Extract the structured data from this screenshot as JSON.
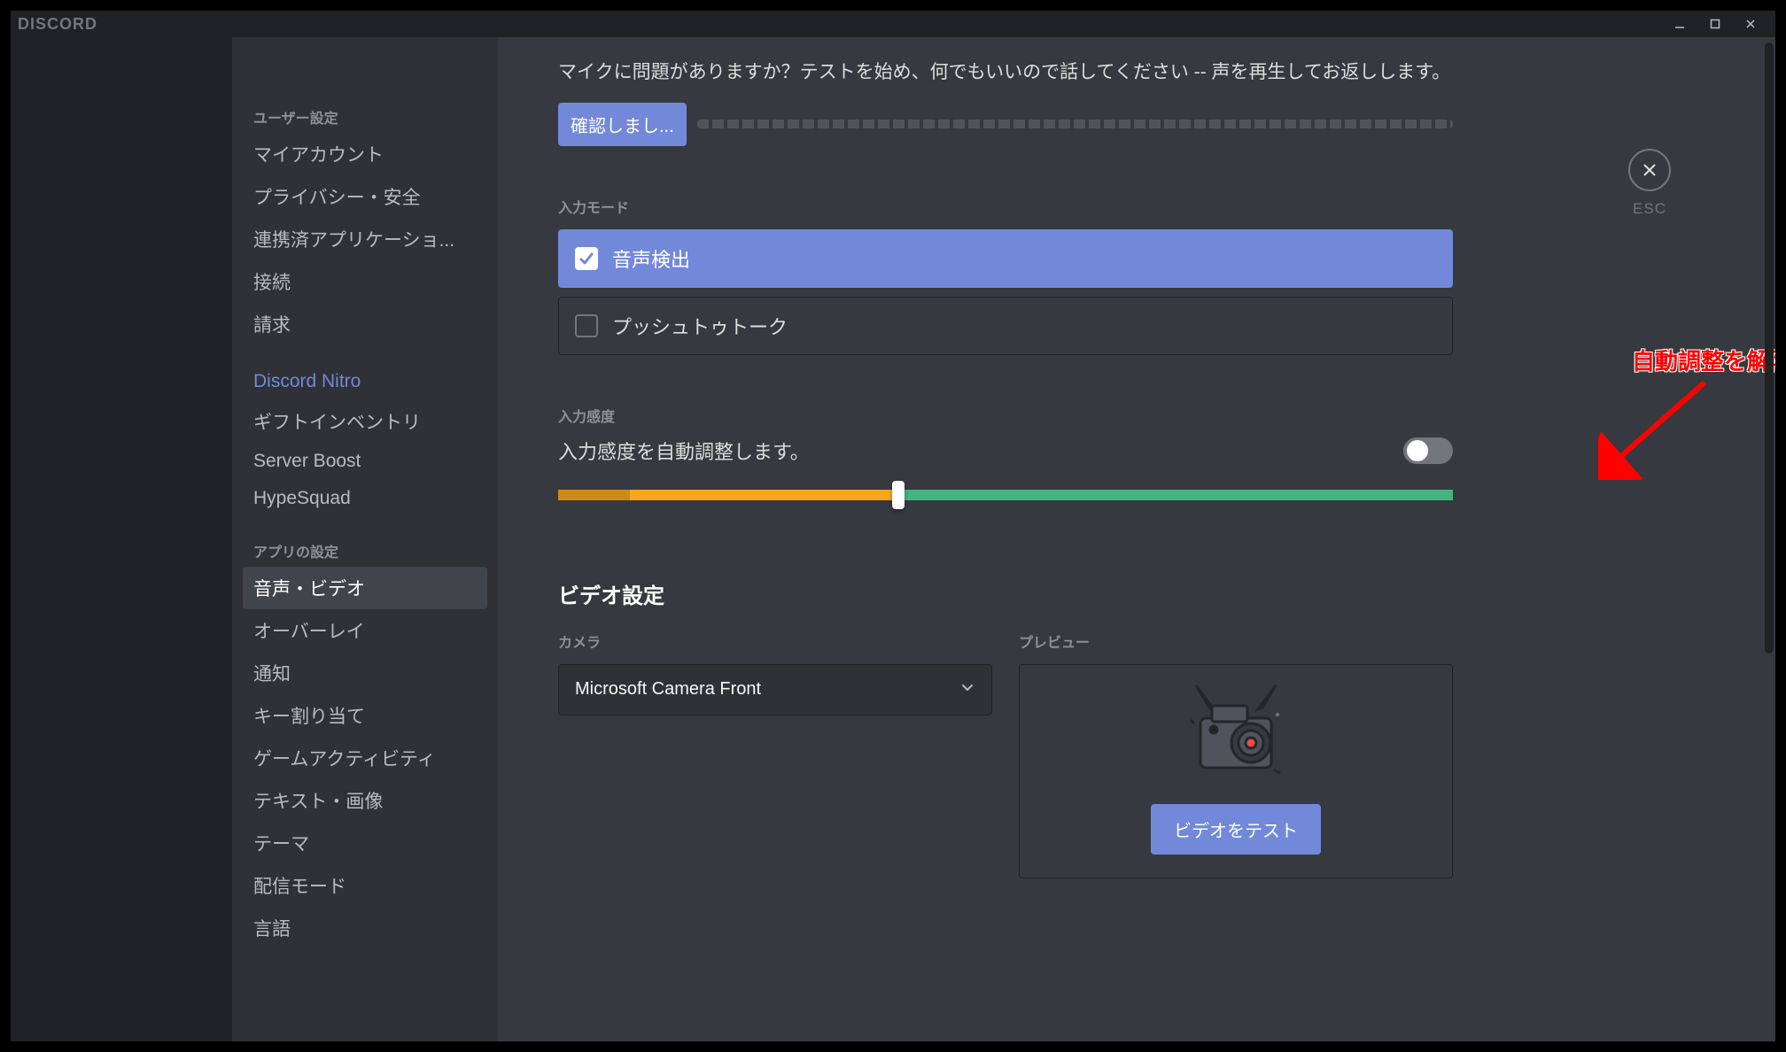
{
  "window": {
    "logo": "DISCORD"
  },
  "sidebar": {
    "section_user": "ユーザー設定",
    "items_user": [
      "マイアカウント",
      "プライバシー・安全",
      "連携済アプリケーショ...",
      "接続",
      "請求"
    ],
    "nitro": "Discord Nitro",
    "items_nitro_sub": [
      "ギフトインベントリ",
      "Server Boost",
      "HypeSquad"
    ],
    "section_app": "アプリの設定",
    "items_app": [
      "音声・ビデオ",
      "オーバーレイ",
      "通知",
      "キー割り当て",
      "ゲームアクティビティ",
      "テキスト・画像",
      "テーマ",
      "配信モード",
      "言語"
    ],
    "active_index": 0
  },
  "esc": {
    "label": "ESC"
  },
  "mic": {
    "help_text": "マイクに問題がありますか？テストを始め、何でもいいので話してください -- 声を再生してお返しします。",
    "check_button": "確認しまし..."
  },
  "input_mode": {
    "label": "入力モード",
    "opt_voice": "音声検出",
    "opt_ptt": "プッシュトゥトーク",
    "selected": "voice"
  },
  "sensitivity": {
    "label": "入力感度",
    "auto_text": "入力感度を自動調整します。",
    "auto_enabled": false,
    "slider_value_pct": 38,
    "slider_dark_pct": 8
  },
  "video": {
    "heading": "ビデオ設定",
    "camera_label": "カメラ",
    "camera_value": "Microsoft Camera Front",
    "preview_label": "プレビュー",
    "test_button": "ビデオをテスト"
  },
  "annotation": {
    "text": "自動調整を解除"
  }
}
